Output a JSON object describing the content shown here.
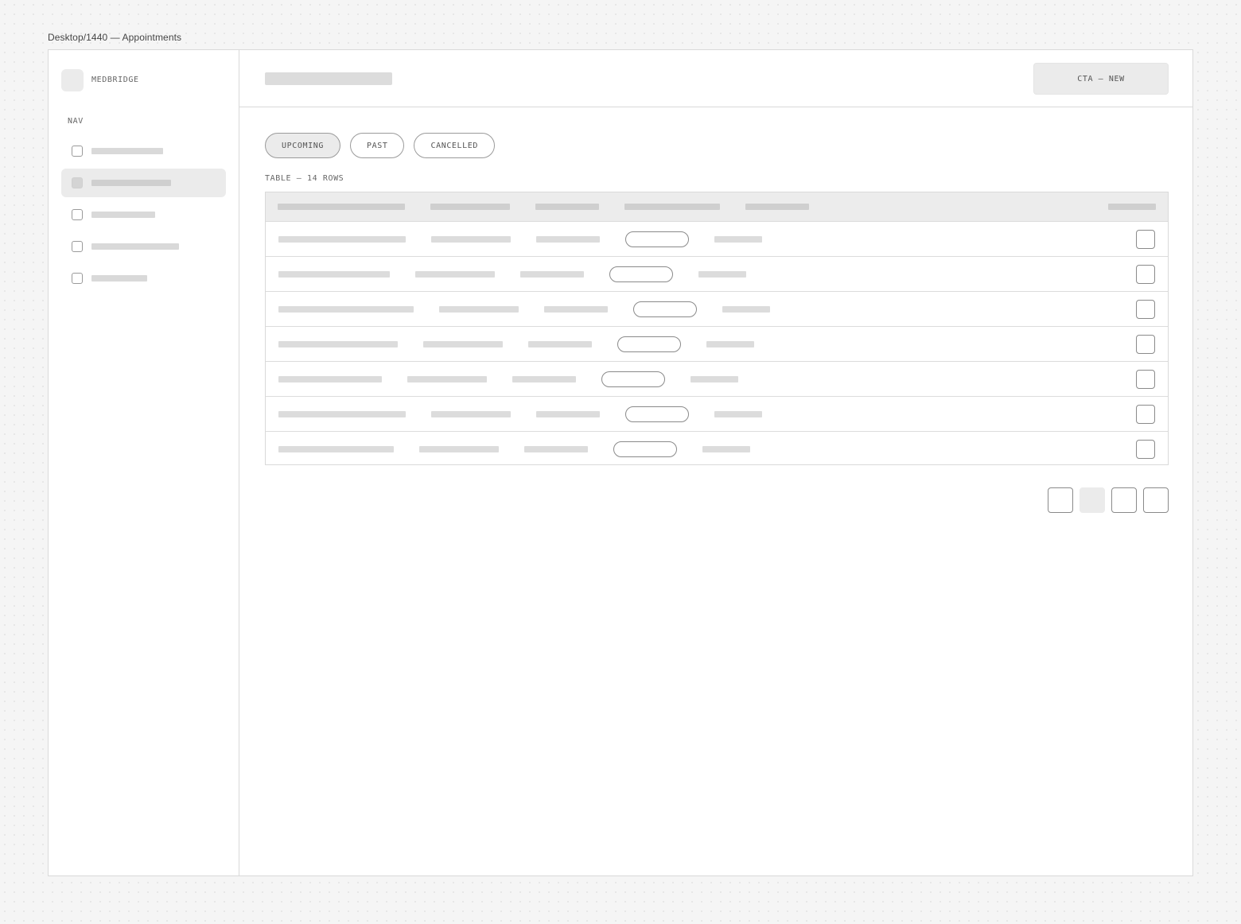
{
  "frame_label": "Desktop/1440 — Appointments",
  "sidebar": {
    "brand": "MEDBRIDGE",
    "nav_heading": "NAV",
    "items": [
      {
        "icon": "square-placeholder-icon",
        "active": false
      },
      {
        "icon": "square-placeholder-icon",
        "active": true
      },
      {
        "icon": "square-placeholder-icon",
        "active": false
      },
      {
        "icon": "square-placeholder-icon",
        "active": false
      },
      {
        "icon": "square-placeholder-icon",
        "active": false
      }
    ]
  },
  "header": {
    "cta_label": "CTA — NEW"
  },
  "tabs": [
    {
      "label": "UPCOMING",
      "active": true
    },
    {
      "label": "PAST",
      "active": false
    },
    {
      "label": "CANCELLED",
      "active": false
    }
  ],
  "table": {
    "caption": "TABLE — 14 ROWS",
    "visible_rows": 7
  },
  "pagination": {
    "buttons": 4,
    "current_index": 1
  },
  "colors": {
    "background": "#f5f5f5",
    "skeleton": "#dcdcdc",
    "active_fill": "#ebebeb",
    "border": "#d9d9d9",
    "outline": "#8a8a8a"
  }
}
